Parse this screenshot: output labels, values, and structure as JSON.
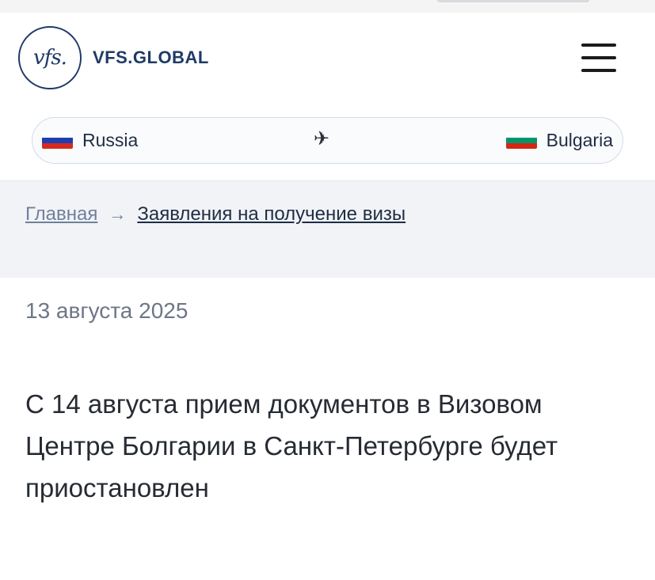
{
  "header": {
    "logo_mark": "vfs.",
    "brand": "VFS.GLOBAL",
    "menu_icon": "hamburger-menu-icon"
  },
  "route": {
    "from": {
      "label": "Russia",
      "flag": [
        "#ffffff",
        "#1c3fb3",
        "#d52b1e"
      ]
    },
    "arrow_icon": "airplane-icon",
    "arrow": "✈",
    "to": {
      "label": "Bulgaria",
      "flag": [
        "#ffffff",
        "#00966e",
        "#d62612"
      ]
    }
  },
  "breadcrumb": {
    "home": "Главная",
    "separator": "→",
    "current": "Заявления на получение визы"
  },
  "article": {
    "date": "13 августа 2025",
    "title": "С 14 августа прием документов в Визовом Центре Болгарии в Санкт-Петербурге будет приостановлен"
  },
  "colors": {
    "brand_navy": "#1f3a66",
    "breadcrumb_bg": "#f1f3f7"
  }
}
